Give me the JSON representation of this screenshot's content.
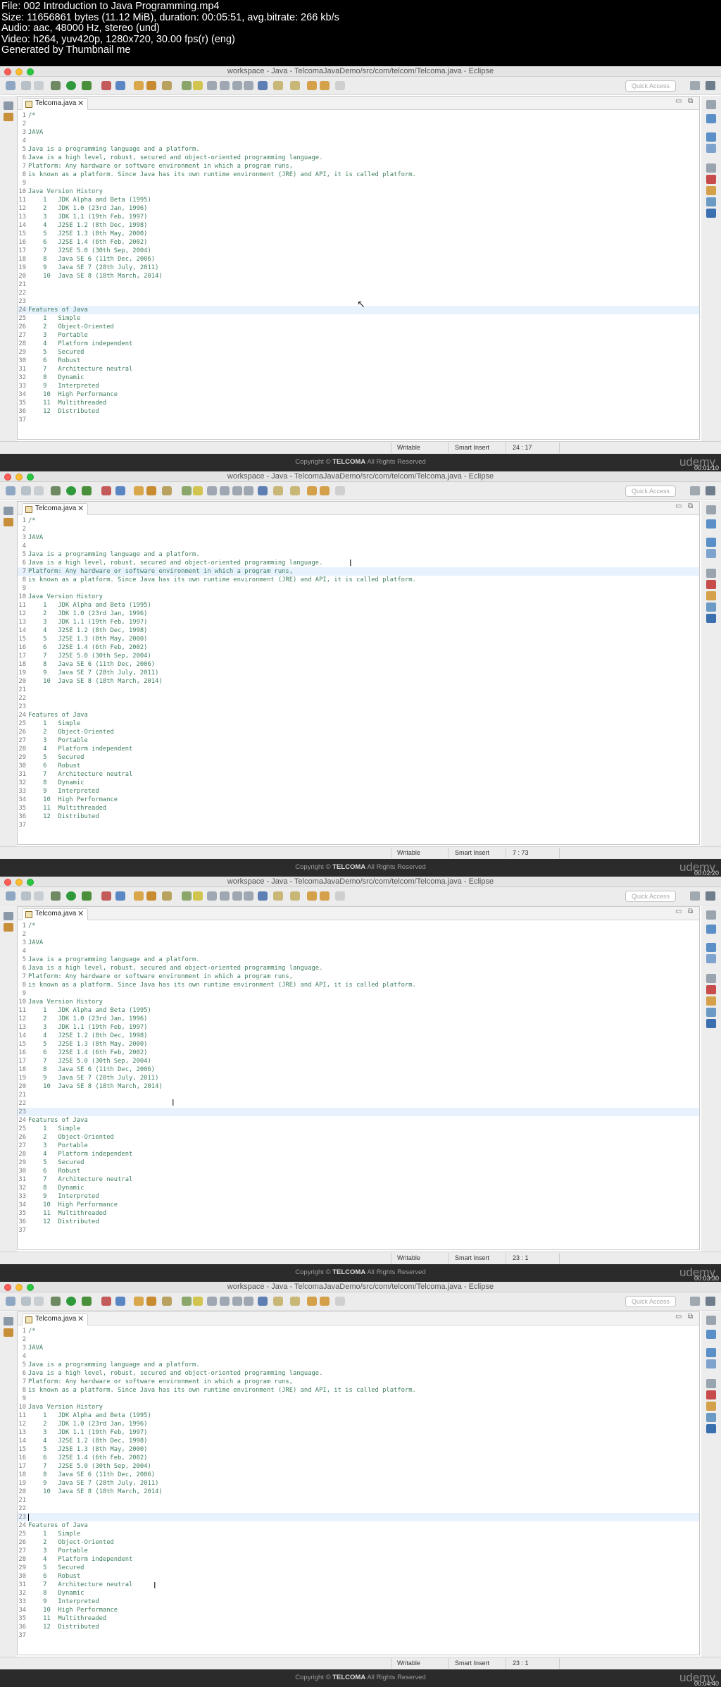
{
  "header": {
    "file": "File: 002 Introduction to Java Programming.mp4",
    "size": "Size: 11656861 bytes (11.12 MiB), duration: 00:05:51, avg.bitrate: 266 kb/s",
    "audio": "Audio: aac, 48000 Hz, stereo (und)",
    "video": "Video: h264, yuv420p, 1280x720, 30.00 fps(r) (eng)",
    "generator": "Generated by Thumbnail me"
  },
  "window": {
    "title": "workspace - Java - TelcomaJavaDemo/src/com/telcom/Telcoma.java - Eclipse",
    "quick_access_placeholder": "Quick Access"
  },
  "editor": {
    "tab_label": "Telcoma.java",
    "lines": [
      "/*",
      "",
      "JAVA",
      "",
      "Java is a programming language and a platform.",
      "Java is a high level, robust, secured and object-oriented programming language.",
      "Platform: Any hardware or software environment in which a program runs,",
      "is known as a platform. Since Java has its own runtime environment (JRE) and API, it is called platform.",
      "",
      "Java Version History",
      "    1   JDK Alpha and Beta (1995)",
      "    2   JDK 1.0 (23rd Jan, 1996)",
      "    3   JDK 1.1 (19th Feb, 1997)",
      "    4   J2SE 1.2 (8th Dec, 1998)",
      "    5   J2SE 1.3 (8th May, 2000)",
      "    6   J2SE 1.4 (6th Feb, 2002)",
      "    7   J2SE 5.0 (30th Sep, 2004)",
      "    8   Java SE 6 (11th Dec, 2006)",
      "    9   Java SE 7 (28th July, 2011)",
      "    10  Java SE 8 (18th March, 2014)",
      "",
      "",
      "",
      "Features of Java",
      "    1   Simple",
      "    2   Object-Oriented",
      "    3   Portable",
      "    4   Platform independent",
      "    5   Secured",
      "    6   Robust",
      "    7   Architecture neutral",
      "    8   Dynamic",
      "    9   Interpreted",
      "    10  High Performance",
      "    11  Multithreaded",
      "    12  Distributed",
      ""
    ]
  },
  "status": {
    "writable": "Writable",
    "insert_mode": "Smart Insert"
  },
  "footer": {
    "copyright_prefix": "Copyright ©",
    "brand": "TELCOMA",
    "copyright_suffix": "All Rights Reserved",
    "udemy": "udemy"
  },
  "frames": [
    {
      "position": "24 : 17",
      "timestamp": "00:01:10",
      "highlight_line": 24
    },
    {
      "position": "7 : 73",
      "timestamp": "00:02:20",
      "highlight_line": 7
    },
    {
      "position": "23 : 1",
      "timestamp": "00:03:30",
      "highlight_line": 23
    },
    {
      "position": "23 : 1",
      "timestamp": "00:04:40",
      "highlight_line": 23
    }
  ]
}
